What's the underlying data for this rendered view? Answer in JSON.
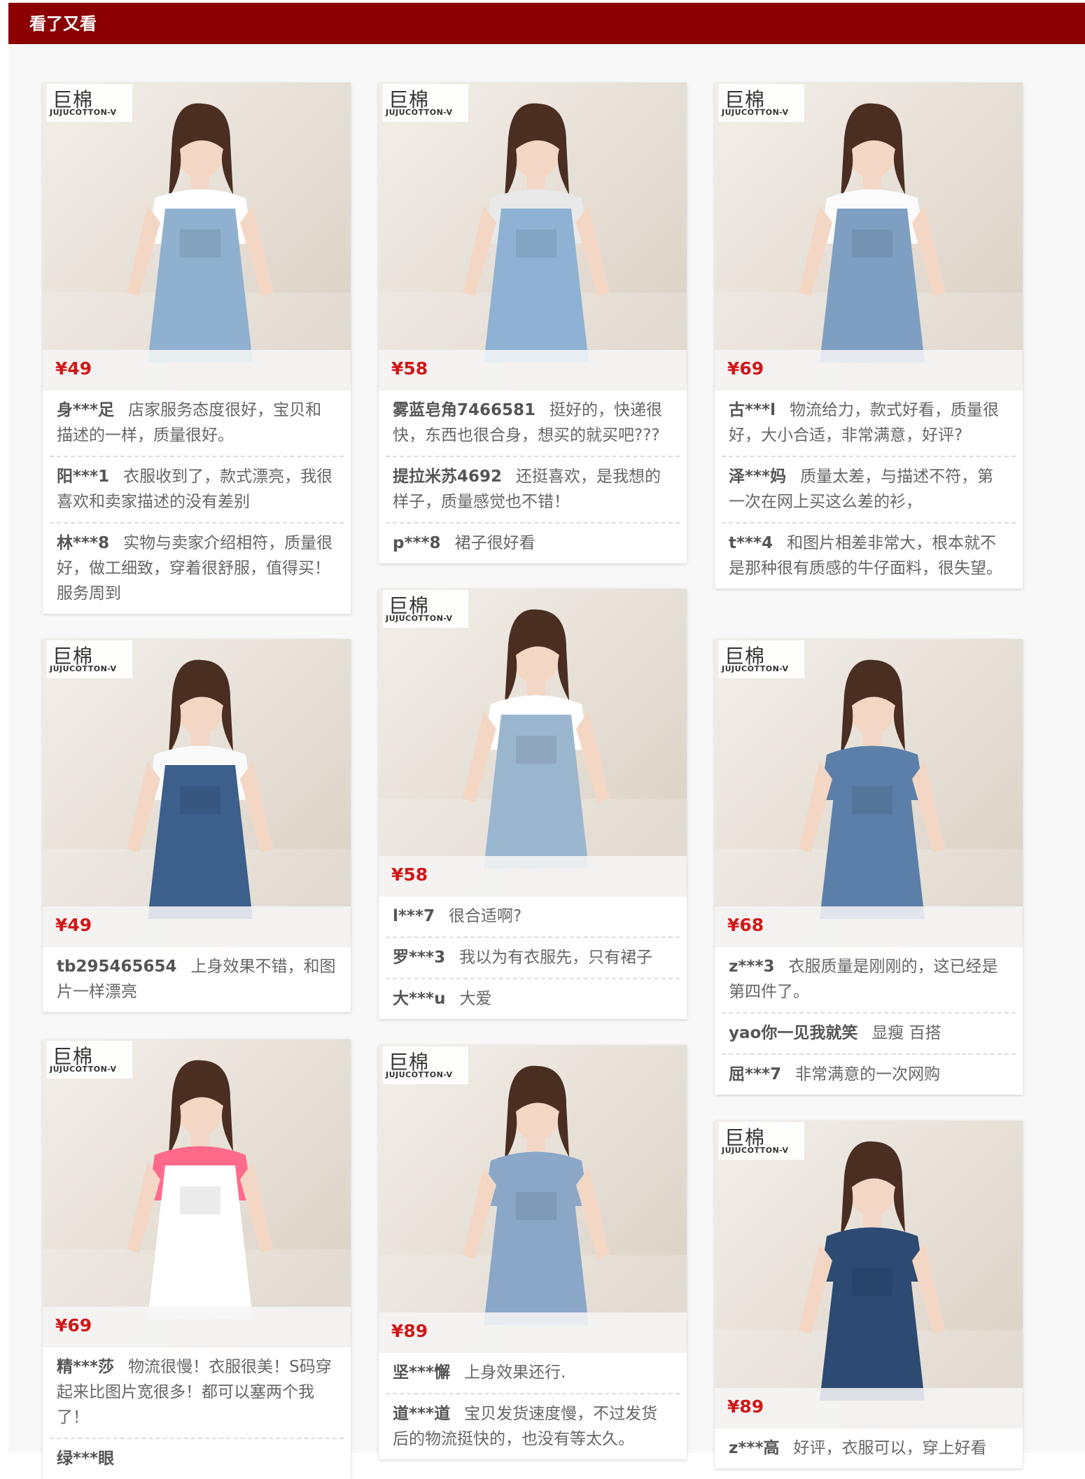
{
  "header": {
    "title": "看了又看"
  },
  "brand": {
    "cn": "巨棉",
    "en": "JUJUCOTTON-V"
  },
  "products": [
    {
      "price": "¥49",
      "image": "denim-overall-dress-icon",
      "reviews": [
        {
          "user": "身***足",
          "text": "店家服务态度很好，宝贝和描述的一样，质量很好。"
        },
        {
          "user": "阳***1",
          "text": "衣服收到了，款式漂亮，我很喜欢和卖家描述的没有差别"
        },
        {
          "user": "林***8",
          "text": "实物与卖家介绍相符，质量很好，做工细致，穿着很舒服，值得买！ 服务周到"
        }
      ]
    },
    {
      "price": "¥58",
      "image": "denim-overall-dress-icon",
      "reviews": [
        {
          "user": "雾蓝皂角7466581",
          "text": "挺好的，快递很快，东西也很合身，想买的就买吧???"
        },
        {
          "user": "提拉米苏4692",
          "text": "还挺喜欢，是我想的样子，质量感觉也不错！"
        },
        {
          "user": "p***8",
          "text": "裙子很好看"
        }
      ]
    },
    {
      "price": "¥69",
      "image": "denim-overall-dress-icon",
      "reviews": [
        {
          "user": "古***l",
          "text": "物流给力，款式好看，质量很好，大小合适，非常满意，好评?"
        },
        {
          "user": "泽***妈",
          "text": "质量太差，与描述不符，第一次在网上买这么差的衫，"
        },
        {
          "user": "t***4",
          "text": "和图片相差非常大，根本就不是那种很有质感的牛仔面料，很失望。"
        }
      ]
    },
    {
      "price": "¥49",
      "image": "tshirt-shorts-icon",
      "reviews": [
        {
          "user": "tb295465654",
          "text": "上身效果不错，和图片一样漂亮"
        }
      ]
    },
    {
      "price": "¥58",
      "image": "denim-overall-dress-icon",
      "reviews": [
        {
          "user": "l***7",
          "text": "很合适啊?"
        },
        {
          "user": "罗***3",
          "text": "我以为有衣服先，只有裙子"
        },
        {
          "user": "大***u",
          "text": "大爱"
        }
      ]
    },
    {
      "price": "¥68",
      "image": "denim-shirt-dress-icon",
      "reviews": [
        {
          "user": "z***3",
          "text": "衣服质量是刚刚的，这已经是第四件了。"
        },
        {
          "user": "yao你一见我就笑",
          "text": "显瘦 百搭"
        },
        {
          "user": "屈***7",
          "text": "非常满意的一次网购"
        }
      ]
    },
    {
      "price": "¥69",
      "image": "white-overall-dress-icon",
      "reviews": [
        {
          "user": "精***莎",
          "text": "物流很慢！衣服很美！S码穿起来比图片宽很多！都可以塞两个我了！"
        },
        {
          "user": "绿***眼",
          "text": ""
        }
      ]
    },
    {
      "price": "¥89",
      "image": "denim-aline-dress-icon",
      "reviews": [
        {
          "user": "坚***懈",
          "text": "上身效果还行."
        },
        {
          "user": "道***道",
          "text": "宝贝发货速度慢，不过发货后的物流挺快的，也没有等太久。"
        }
      ]
    },
    {
      "price": "¥89",
      "image": "denim-shirt-dress-icon",
      "reviews": [
        {
          "user": "z***高",
          "text": "好评，衣服可以，穿上好看"
        }
      ]
    }
  ]
}
